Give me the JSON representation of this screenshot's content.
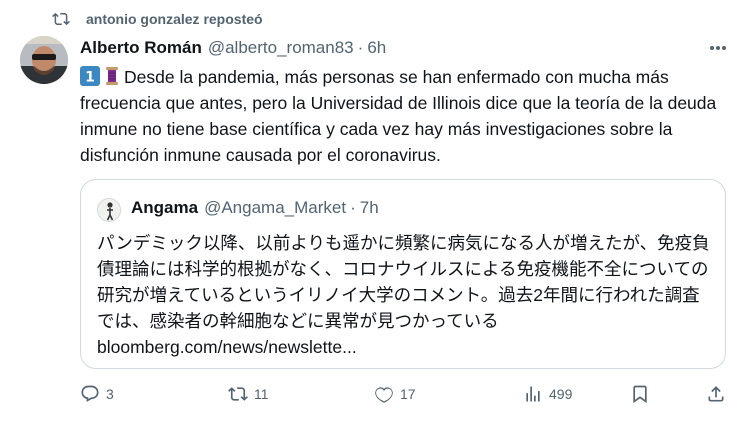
{
  "repost": {
    "text": "antonio gonzalez reposteó",
    "icon": "repost-icon"
  },
  "tweet": {
    "author_name": "Alberto Román",
    "author_handle": "@alberto_roman83",
    "separator": "·",
    "time": "6h",
    "text": "Desde la pandemia, más personas se han enfermado con mucha más frecuencia que antes, pero la Universidad de Illinois dice que la teoría de la deuda inmune no tiene base científica y cada vez hay más investigaciones sobre la disfunción inmune causada por el coronavirus.",
    "emojis": [
      "keycap-one-emoji",
      "thread-spool-emoji"
    ]
  },
  "quote": {
    "author_name": "Angama",
    "author_handle": "@Angama_Market",
    "separator": "·",
    "time": "7h",
    "text": "パンデミック以降、以前よりも遥かに頻繁に病気になる人が増えたが、免疫負債理論には科学的根拠がなく、コロナウイルスによる免疫機能不全についての研究が増えているというイリノイ大学のコメント。過去2年間に行われた調査では、感染者の幹細胞などに異常が見つかっている",
    "link": "bloomberg.com/news/newslette..."
  },
  "actions": {
    "replies": "3",
    "reposts": "11",
    "likes": "17",
    "views": "499"
  },
  "colors": {
    "text": "#0f1419",
    "secondary": "#536471",
    "border": "#cfd9de"
  }
}
